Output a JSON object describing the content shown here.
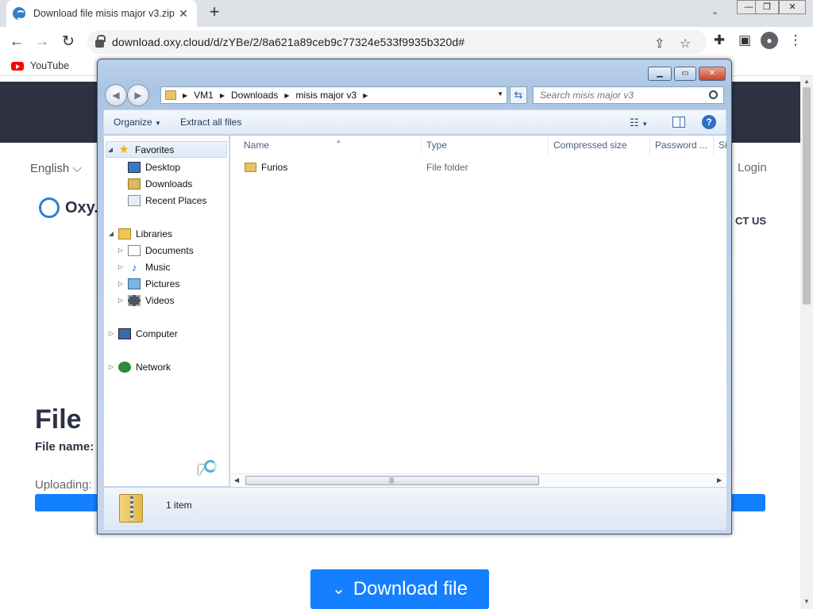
{
  "browser": {
    "tab_title": "Download file misis major v3.zip",
    "tab_close": "✕",
    "new_tab": "+",
    "url": "download.oxy.cloud/d/zYBe/2/8a621a89ceb9c77324e533f9935b320d#",
    "bookmark_youtube": "YouTube",
    "icons": {
      "back": "back-arrow-icon",
      "forward": "forward-arrow-icon",
      "reload": "reload-icon",
      "share": "share-icon",
      "star": "star-icon",
      "extensions": "puzzle-icon",
      "sidepanel": "side-panel-icon",
      "profile": "profile-icon",
      "menu": "kebab-menu-icon"
    }
  },
  "site": {
    "language": "English",
    "login": "Login",
    "logo_text": "Oxy.C",
    "contact": "CT US",
    "heading": "File",
    "file_name_label": "File name:",
    "uploading_label": "Uploading:",
    "progress_percent": 100,
    "download_button": "Download file",
    "accent_color": "#1480ff",
    "header_color": "#2d3142"
  },
  "explorer": {
    "breadcrumb": [
      "VM1",
      "Downloads",
      "misis major v3"
    ],
    "search_placeholder": "Search misis major v3",
    "toolbar": {
      "organize": "Organize",
      "extract": "Extract all files"
    },
    "nav": {
      "favorites": "Favorites",
      "desktop": "Desktop",
      "downloads": "Downloads",
      "recent": "Recent Places",
      "libraries": "Libraries",
      "documents": "Documents",
      "music": "Music",
      "pictures": "Pictures",
      "videos": "Videos",
      "computer": "Computer",
      "network": "Network"
    },
    "columns": [
      "Name",
      "Type",
      "Compressed size",
      "Password ...",
      "Si"
    ],
    "files": [
      {
        "name": "Furios",
        "type": "File folder"
      }
    ],
    "status": "1 item"
  }
}
